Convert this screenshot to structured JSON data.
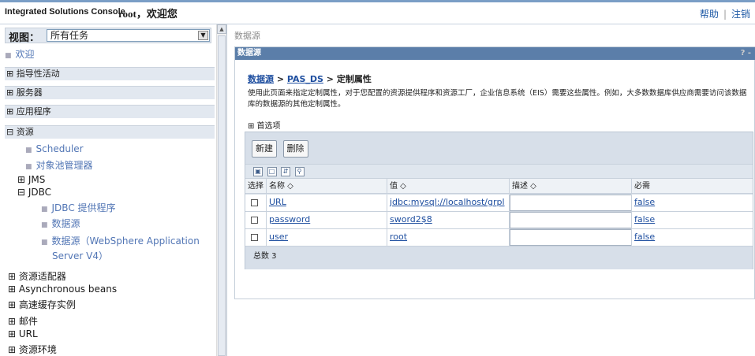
{
  "header": {
    "app_title": "Integrated Solutions Console",
    "user_welcome": "root，欢迎您",
    "help_link": "帮助",
    "logout_link": "注销"
  },
  "nav": {
    "view_label": "视图：",
    "view_select": "所有任务",
    "welcome": "欢迎",
    "sections": {
      "guided": "⊞ 指导性活动",
      "servers": "⊞ 服务器",
      "apps": "⊞ 应用程序",
      "resources": "⊟ 资源"
    },
    "resources": {
      "scheduler": "Scheduler",
      "object_pool": "对象池管理器",
      "jms": "⊞ JMS",
      "jdbc": "⊟ JDBC",
      "jdbc_provider": "JDBC 提供程序",
      "datasource": "数据源",
      "datasource_ws_line1": "数据源（WebSphere Application",
      "datasource_ws_line2": "Server V4）",
      "adapters": "⊞ 资源适配器",
      "async_beans": "⊞ Asynchronous beans",
      "cache": "⊞ 高速缓存实例",
      "mail": "⊞ 邮件",
      "url": "⊞ URL",
      "env": "⊞ 资源环境"
    }
  },
  "content": {
    "top_crumb": "数据源",
    "panel_title": "数据源",
    "panel_help": "? -",
    "path": {
      "part1": "数据源",
      "sep1": " > ",
      "part2": "PAS_DS",
      "sep2": " > ",
      "part3": "定制属性"
    },
    "description": "使用此页面来指定定制属性，对于您配置的资源提供程序和资源工厂，企业信息系统（EIS）需要这些属性。例如，大多数数据库供应商需要访问该数据库的数据源的其他定制属性。",
    "preferences": "⊞ 首选项",
    "buttons": {
      "new": "新建",
      "delete": "删除"
    },
    "columns": {
      "select": "选择",
      "name": "名称 ◇",
      "value": "值 ◇",
      "desc": "描述 ◇",
      "required": "必需"
    },
    "rows": [
      {
        "name": "URL",
        "value": "jdbc:mysql://localhost/grpl",
        "desc": "",
        "required": "false"
      },
      {
        "name": "password",
        "value": "sword2$8",
        "desc": "",
        "required": "false"
      },
      {
        "name": "user",
        "value": "root",
        "desc": "",
        "required": "false"
      }
    ],
    "total": "总数 3"
  }
}
